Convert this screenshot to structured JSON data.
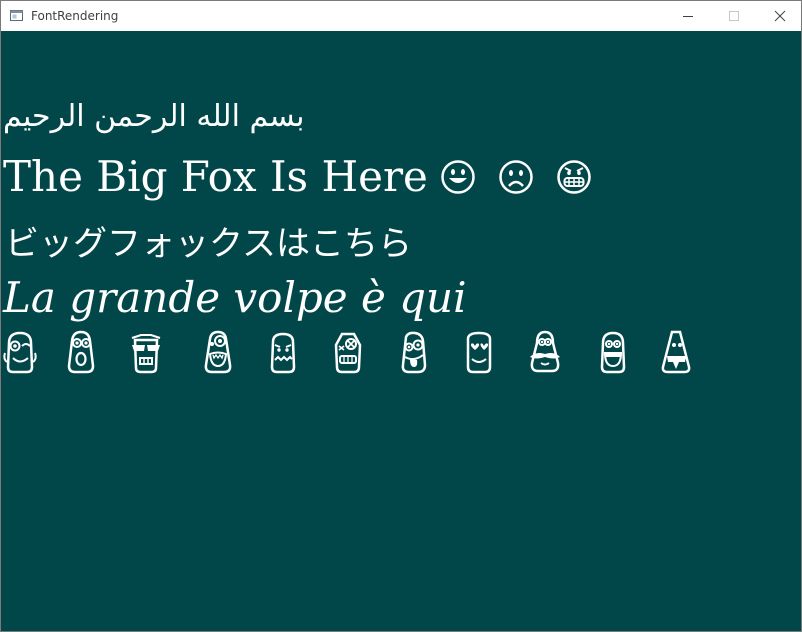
{
  "window": {
    "title": "FontRendering",
    "controls": [
      "minimize",
      "maximize",
      "close"
    ],
    "client_background": "#01474a",
    "text_color": "#ffffff"
  },
  "lines": {
    "arabic": "بسم الله الرحمن الرحيم",
    "english": "The Big Fox Is Here",
    "english_emoji": [
      "grinning-face-icon",
      "frowning-face-icon",
      "grimacing-face-icon"
    ],
    "japanese": "ビッグフォックスはこちら",
    "italian": "La grande volpe è qui"
  },
  "creature_icons": [
    "winking-creature-icon",
    "surprised-creature-icon",
    "sunglasses-creature-icon",
    "screaming-creature-icon",
    "nervous-creature-icon",
    "dizzy-creature-icon",
    "tongue-out-creature-icon",
    "love-creature-icon",
    "mustache-creature-icon",
    "shouting-creature-icon",
    "cone-head-creature-icon"
  ]
}
